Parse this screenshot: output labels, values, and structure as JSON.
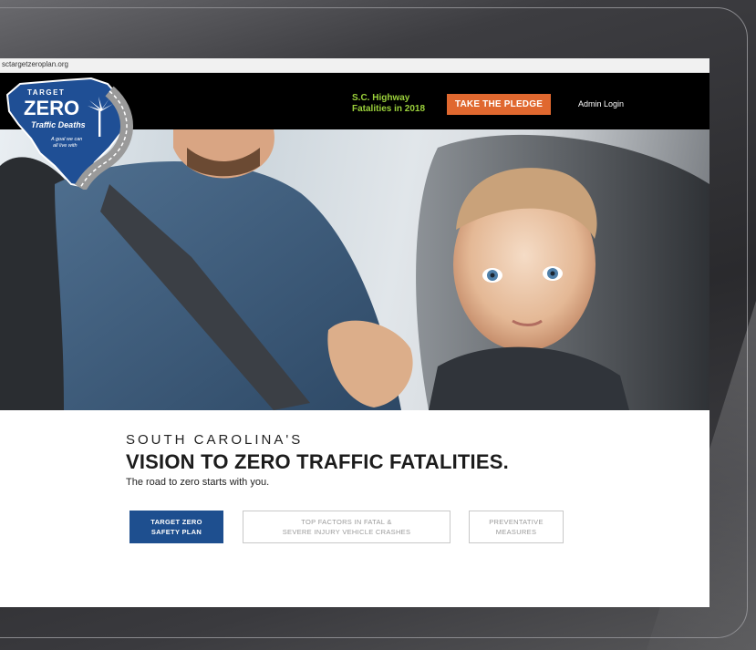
{
  "browser": {
    "url": "sctargetzeroplan.org"
  },
  "logo": {
    "top_text": "TARGET",
    "main_text": "ZERO",
    "sub_text": "Traffic Deaths",
    "tagline_1": "A goal we can",
    "tagline_2": "all live with"
  },
  "nav": {
    "stat_line1": "S.C. Highway",
    "stat_line2": "Fatalities in 2018",
    "pledge_label": "TAKE THE PLEDGE",
    "admin_label": "Admin Login"
  },
  "main": {
    "eyebrow": "SOUTH CAROLINA'S",
    "headline": "VISION TO ZERO TRAFFIC FATALITIES.",
    "subtitle": "The road to zero starts with you.",
    "buttons": [
      {
        "line1": "TARGET ZERO",
        "line2": "SAFETY PLAN"
      },
      {
        "line1": "TOP FACTORS IN FATAL &",
        "line2": "SEVERE INJURY VEHICLE CRASHES"
      },
      {
        "line1": "PREVENTATIVE",
        "line2": "MEASURES"
      }
    ]
  },
  "colors": {
    "nav_bg": "#000000",
    "stat_green": "#9bd13b",
    "pledge_orange": "#e0682f",
    "primary_blue": "#1e4f8f"
  }
}
